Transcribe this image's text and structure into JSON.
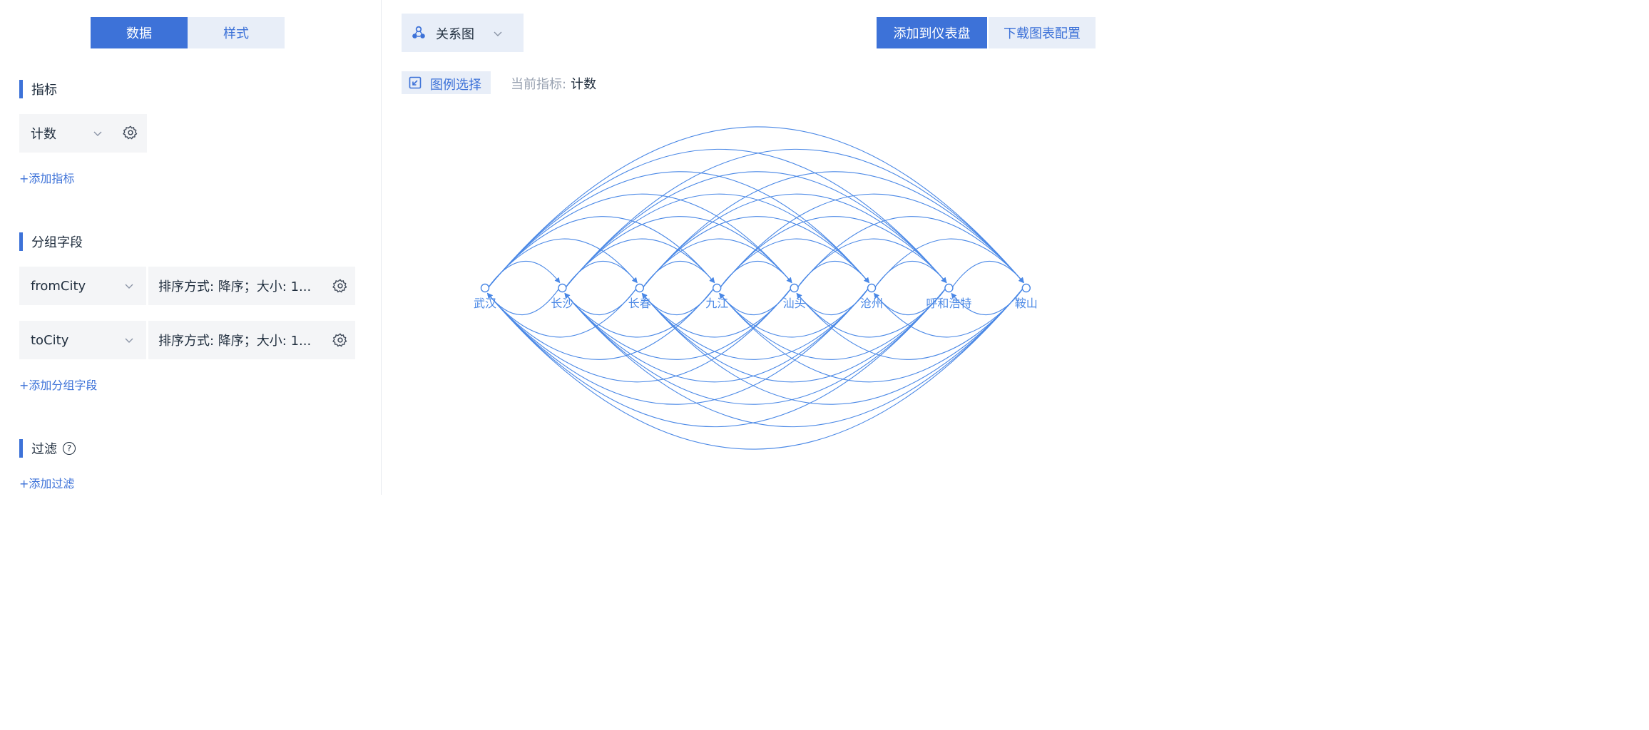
{
  "tabs": {
    "data": "数据",
    "style": "样式"
  },
  "metrics": {
    "title": "指标",
    "field_value": "计数",
    "add_label": "+添加指标"
  },
  "groups": {
    "title": "分组字段",
    "fields": [
      {
        "name": "fromCity",
        "sort": "排序方式: 降序；大小: 1..."
      },
      {
        "name": "toCity",
        "sort": "排序方式: 降序；大小: 1..."
      }
    ],
    "add_label": "+添加分组字段"
  },
  "filter": {
    "title": "过滤",
    "help": "?",
    "add_label": "+添加过滤"
  },
  "chart_type": {
    "label": "关系图"
  },
  "actions": {
    "add_dashboard": "添加到仪表盘",
    "download_config": "下载图表配置"
  },
  "legend": {
    "label": "图例选择"
  },
  "current_metric": {
    "label": "当前指标:",
    "value": "计数"
  },
  "colors": {
    "accent": "#3d72d8",
    "edge": "#4a88e6",
    "panel_bg": "#f4f5f7",
    "soft_blue": "#e8eef8"
  },
  "chart_data": {
    "type": "graph",
    "nodes": [
      "武汉",
      "长沙",
      "长春",
      "九江",
      "汕头",
      "沧州",
      "呼和浩特",
      "鞍山"
    ],
    "edges": "all ordered pairs (fromCity → toCity)"
  }
}
